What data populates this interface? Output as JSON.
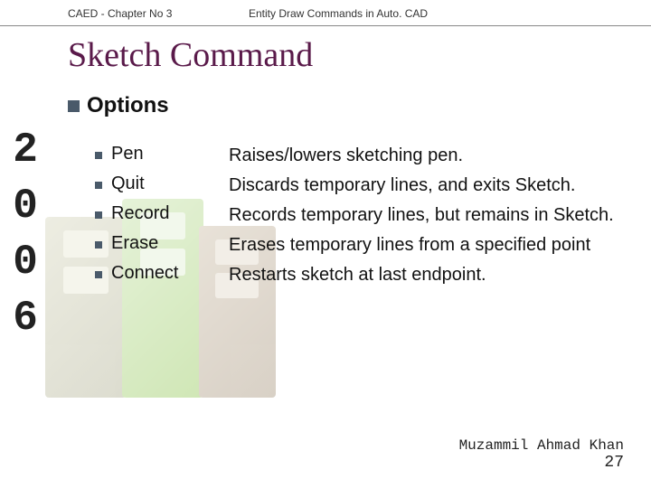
{
  "header": {
    "left": "CAED - Chapter No 3",
    "right": "Entity Draw Commands in Auto. CAD"
  },
  "title": "Sketch Command",
  "side_year": "2006",
  "section_heading": "Options",
  "options": [
    {
      "name": "Pen",
      "desc": "Raises/lowers sketching pen."
    },
    {
      "name": "Quit",
      "desc": "Discards temporary lines, and exits Sketch."
    },
    {
      "name": "Record",
      "desc": "Records temporary lines, but remains in Sketch."
    },
    {
      "name": "Erase",
      "desc": "Erases temporary lines from a specified point"
    },
    {
      "name": "Connect",
      "desc": "Restarts sketch at last endpoint."
    }
  ],
  "footer": {
    "author": "Muzammil Ahmad Khan",
    "page": "27"
  }
}
